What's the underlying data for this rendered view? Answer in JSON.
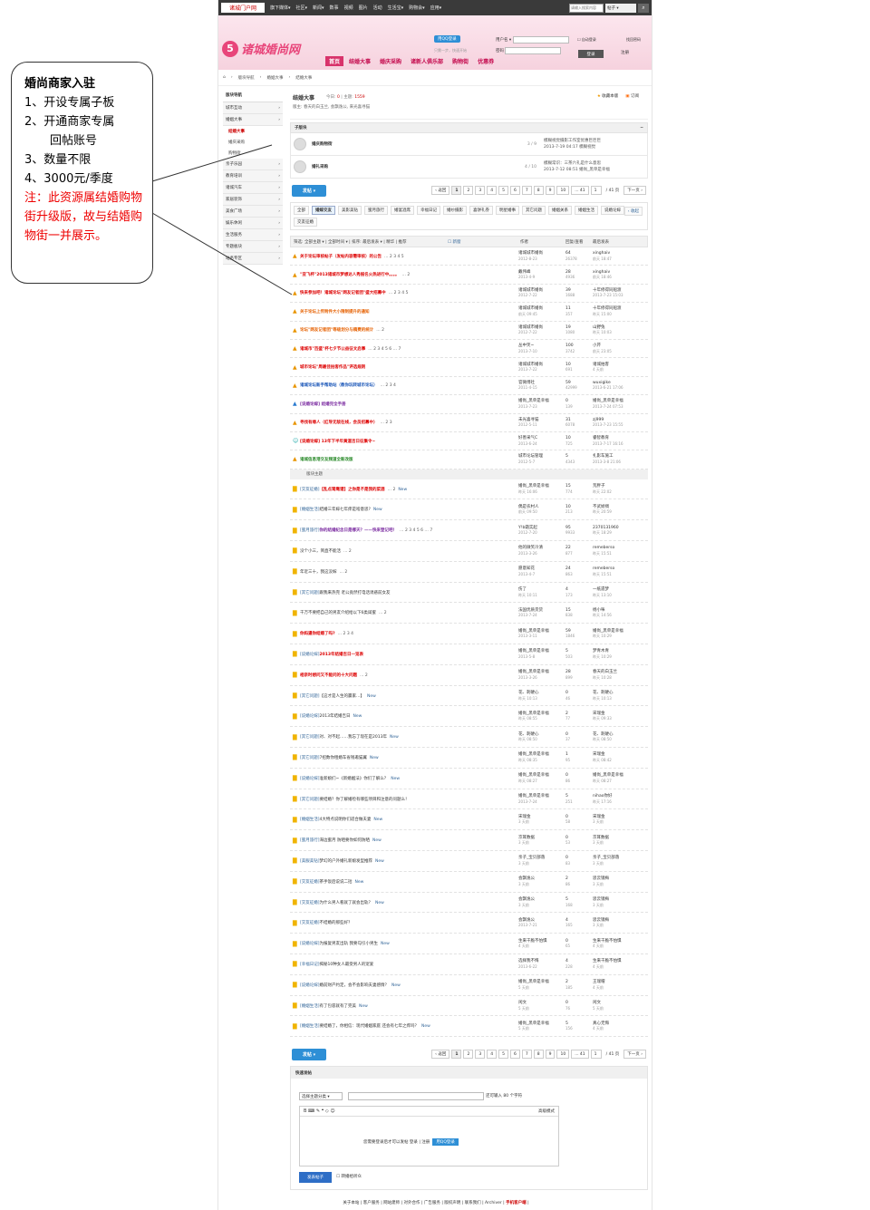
{
  "callout": {
    "title": "婚尚商家入驻",
    "lines": [
      "1、开设专属子板",
      "2、开通商家专属",
      "回帖账号",
      "3、数量不限",
      "4、3000元/季度"
    ],
    "note": "注：此资源属结婚购物街升级版，故与结婚购物街一并展示。"
  },
  "topbar": {
    "logo": "诸城门户网",
    "nav": [
      "旗下媒体▾",
      "社区▾",
      "新闻▾",
      "数事",
      "视频",
      "图片",
      "活动",
      "生活宝▾",
      "购物会▾",
      "应用▾"
    ],
    "search_placeholder": "请输入搜索内容",
    "search_select": "帖子 ▾",
    "search_icon": "magnifier"
  },
  "header": {
    "brand": "诸城婚尚网",
    "qq_login": "用QQ登录",
    "qq_sub": "只需一步，快速开始",
    "user_label": "用户名 ▾",
    "pass_label": "密码",
    "remember": "自动登录",
    "forgot": "找回密码",
    "login_btn": "登录",
    "register_btn": "注册"
  },
  "mainnav": [
    "首页",
    "结婚大事",
    "婚庆采购",
    "诸新人俱乐部",
    "购物街",
    "优惠券"
  ],
  "crumb": [
    "⌂",
    "›",
    "版块导航",
    "›",
    "婚姻大事",
    "›",
    "结婚大事"
  ],
  "sidebar": {
    "head": "版块导航",
    "items": [
      {
        "label": "城市互动",
        "sub": []
      },
      {
        "label": "婚姻大事",
        "sub": [
          "结婚大事",
          "婚庆采购",
          "购物街"
        ]
      },
      {
        "label": "亲子乐园",
        "sub": []
      },
      {
        "label": "教育培训",
        "sub": []
      },
      {
        "label": "诸城汽车",
        "sub": []
      },
      {
        "label": "家居装饰",
        "sub": []
      },
      {
        "label": "美食广场",
        "sub": []
      },
      {
        "label": "娱乐休闲",
        "sub": []
      },
      {
        "label": "生活服务",
        "sub": []
      },
      {
        "label": "专题板块",
        "sub": []
      },
      {
        "label": "站务专区",
        "sub": []
      }
    ]
  },
  "forum": {
    "title": "结婚大事",
    "today_label": "今日:",
    "today": "0",
    "topics_label": "主题:",
    "topics": "1559",
    "mods": "版主: 春天的白玉兰, 会飘逸公, 来光喜寻猫",
    "fav": "收藏本版",
    "rss": "订阅"
  },
  "subforum": {
    "head": "子版块",
    "collapse": "−",
    "rows": [
      {
        "name": "婚庆购物街",
        "count": "3 / 9",
        "last1": "模糊视觉摄影工作室优惠巨巨巨",
        "last2": "2013-7-19 04:17 模糊视觉"
      },
      {
        "name": "婚礼采购",
        "count": "4 / 10",
        "last1": "模糊常识：三茶六礼是什么意思",
        "last2": "2013-7-12 08:51 婚尚_黑单是幸福"
      }
    ]
  },
  "pager": {
    "post": "发帖 ▾",
    "prev": "‹ 返回",
    "pages": [
      "1",
      "2",
      "3",
      "4",
      "5",
      "6",
      "7",
      "8",
      "9",
      "10",
      "... 41"
    ],
    "total": "/ 41 页",
    "next": "下一页 ›",
    "jump": "1"
  },
  "tags": {
    "list": [
      "全部",
      "婚嫁交友",
      "美影美钻",
      "蜜月旅行",
      "婚宴酒席",
      "幸福日记",
      "婚纱摄影",
      "喜饼礼券",
      "明星婚事",
      "其它问题",
      "婚姻关系",
      "婚姻生活",
      "说婚论嫁",
      "交友征婚"
    ],
    "collapse": "‹ 收起"
  },
  "filter": {
    "all": "筛选: 全部主题 ▾",
    "time": "全部时间 ▾",
    "sort": "排序: 最后发表 ▾",
    "hot": "精华",
    "rec": "推荐",
    "new": "新窗",
    "author": "作者",
    "reply": "回复/查看",
    "last": "最后发表"
  },
  "pinned": [
    {
      "icon": "▲",
      "cls": "t-red",
      "title": "关于论坛审核帖子（发帖内容需审核）的公告",
      "pages": "… 2 3 4 5",
      "author": "诸城城市婚尚",
      "adate": "2012-8-23",
      "r": "64",
      "v": "26378",
      "lp": "xinghaiv",
      "ld": "前天 18:47"
    },
    {
      "icon": "▲",
      "cls": "t-red",
      "title": "\"亚飞杯\"2013诸城市梦想达人秀报名火热进行中。。。。",
      "pages": "… 2",
      "author": "戴伟峰",
      "adate": "2013-4-9",
      "r": "28",
      "v": "4936",
      "lp": "xinghaiv",
      "ld": "前天 18:46"
    },
    {
      "icon": "▲",
      "cls": "t-red",
      "title": "快来参加吧！诸城论坛\"网友记者团\"盛大招募中",
      "pages": "… 2 3 4 5",
      "author": "诸城城市婚尚",
      "adate": "2012-7-22",
      "r": "39",
      "v": "1688",
      "lp": "十年修得同船渡",
      "ld": "2013-7-23 15:03"
    },
    {
      "icon": "▲",
      "cls": "t-org",
      "title": "关于论坛上传附件大小限制提升的通知",
      "pages": "",
      "author": "诸城城市婚尚",
      "adate": "前天 09:45",
      "r": "11",
      "v": "357",
      "lp": "十年修得同船渡",
      "ld": "昨天 15:00"
    },
    {
      "icon": "▲",
      "cls": "t-org",
      "title": "论坛\"网友记者团\"等级划分与稿费的统计",
      "pages": "… 2",
      "author": "诸城城市婚尚",
      "adate": "2012-7-22",
      "r": "19",
      "v": "1080",
      "lp": "山野兔",
      "ld": "昨天 10:03"
    },
    {
      "icon": "▲",
      "cls": "t-red",
      "title": "诸城市\"百盛\"杯七夕节公益征文启事",
      "pages": "… 2 3 4 5 6 … 7",
      "author": "丛中笑~",
      "adate": "2013-7-10",
      "r": "100",
      "v": "3742",
      "lp": "小芹",
      "ld": "前天 23:05"
    },
    {
      "icon": "▲",
      "cls": "t-red",
      "title": "城市论坛\"周最佳拍客作品\"评选规则",
      "pages": "",
      "author": "诸城城市婚尚",
      "adate": "2013-7-22",
      "r": "10",
      "v": "691",
      "lp": "诸城拍客",
      "ld": "4 天前"
    },
    {
      "icon": "▲",
      "cls": "t-blue",
      "title": "诸城论坛新手帮助站（教你玩转城市论坛）",
      "pages": "… 2 3 4",
      "author": "官微博社",
      "adate": "2011-4-15",
      "r": "59",
      "v": "42999",
      "lp": "wuxigike",
      "ld": "2013-6-21 17:06"
    },
    {
      "icon": "▲",
      "cls": "t-purple",
      "title": "[说婚论嫁] 结婚完全手册",
      "pages": "",
      "author": "婚尚_黑单是幸福",
      "adate": "2013-7-23",
      "r": "0",
      "v": "139",
      "lp": "婚尚_黑单是幸福",
      "ld": "2013-7-24 07:53"
    },
    {
      "icon": "▲",
      "cls": "t-red",
      "title": "寻找有缘人（红导无敌在线，会员招募中）",
      "pages": "… 2 3",
      "author": "未光喜寻猫",
      "adate": "2012-5-11",
      "r": "31",
      "v": "6078",
      "lp": "zj999",
      "ld": "2013-7-23 15:55"
    },
    {
      "icon": "☺",
      "cls": "t-red",
      "title": "[说婚论嫁] 13年下半年黄道吉日征集令~",
      "pages": "",
      "author": "好善采气C",
      "adate": "2013-6-24",
      "r": "10",
      "v": "725",
      "lp": "睿智教育",
      "ld": "2013-7-17 16:16"
    },
    {
      "icon": "▲",
      "cls": "t-green",
      "title": "诸城信息港交友频道全新改版",
      "pages": "",
      "author": "城市论坛管理",
      "adate": "2012-5-7",
      "r": "5",
      "v": "4343",
      "lp": "扎影车施工",
      "ld": "2013-3-8 21:06"
    }
  ],
  "sep": "版块主题",
  "normal": [
    {
      "tag": "[交友征婚]",
      "cls": "t-red",
      "title": "【乱点鸳鸯谱】之你是不是我的菜酒",
      "pages": "… 2",
      "nw": "New",
      "author": "婚尚_黑单是幸福",
      "adate": "昨天 16:06",
      "r": "15",
      "v": "774",
      "lp": "荒胖子",
      "ld": "昨天 22:02"
    },
    {
      "tag": "[婚姻生活]",
      "cls": "t-plain",
      "title": "结婚三年嫁七年痒是啥意思?",
      "pages": "",
      "nw": "New",
      "author": "偶是农村人",
      "adate": "前天 09:50",
      "r": "10",
      "v": "213",
      "lp": "不武娇绸",
      "ld": "昨天 20:59"
    },
    {
      "tag": "[蜜月旅行]",
      "cls": "t-purple",
      "title": "你的结婚纪念日是哪天？——快来登记吧！",
      "pages": "… 2 3 4 5 6 … 7",
      "nw": "",
      "author": "Y!b霜实起",
      "adate": "2012-7-20",
      "r": "95",
      "v": "9933",
      "lp": "2370131960",
      "ld": "昨天 18:29"
    },
    {
      "tag": "",
      "cls": "t-plain",
      "title": "没个小三，简直不能活",
      "pages": "… 2",
      "nw": "",
      "author": "他的微笑冷清",
      "adate": "2013-3-26",
      "r": "22",
      "v": "877",
      "lp": "remeberso",
      "ld": "昨天 15:51"
    },
    {
      "tag": "",
      "cls": "t-plain",
      "title": "年近三十，我这没嫁",
      "pages": "… 2",
      "nw": "",
      "author": "愿意知花",
      "adate": "2013-4-7",
      "r": "24",
      "v": "863",
      "lp": "remeberso",
      "ld": "昨天 15:51"
    },
    {
      "tag": "[其它问题]",
      "cls": "t-plain",
      "title": "跟我来热完 老公竟然打电话诱惑前女友",
      "pages": "",
      "nw": "",
      "author": "伤了",
      "adate": "昨天 10:11",
      "r": "4",
      "v": "173",
      "lp": "一纸遗梦",
      "ld": "昨天 13:10"
    },
    {
      "tag": "",
      "cls": "t-plain",
      "title": "千万不要把自己的男友介绍给以下6类闺蜜",
      "pages": "… 2",
      "nw": "",
      "author": "法国优质货货",
      "adate": "2013-7-24",
      "r": "15",
      "v": "838",
      "lp": "杨小咪",
      "ld": "昨天 14:56"
    },
    {
      "tag": "",
      "cls": "t-red",
      "title": "你妈逼你结婚了吗?",
      "pages": "… 2 3 4",
      "nw": "",
      "author": "婚尚_黑单是幸福",
      "adate": "2013-3-11",
      "r": "59",
      "v": "1846",
      "lp": "婚尚_黑单是幸福",
      "ld": "昨天 10:29"
    },
    {
      "tag": "[说婚论嫁]",
      "cls": "t-red",
      "title": "2013年结婚吉日一览表",
      "pages": "",
      "nw": "",
      "author": "婚尚_黑单是幸福",
      "adate": "2013-5-8",
      "r": "5",
      "v": "503",
      "lp": "梦青木青",
      "ld": "昨天 10:29"
    },
    {
      "tag": "",
      "cls": "t-red",
      "title": "相亲时想问又不能问的十大问题",
      "pages": "… 2",
      "nw": "",
      "author": "婚尚_黑单是幸福",
      "adate": "2013-3-26",
      "r": "28",
      "v": "899",
      "lp": "春天的白玉兰",
      "ld": "昨天 10:28"
    },
    {
      "tag": "[其它问题]",
      "cls": "t-plain",
      "title": "【这才是人生的赢家…】",
      "pages": "",
      "nw": "New",
      "author": "花、刺硬心",
      "adate": "昨天 10:13",
      "r": "0",
      "v": "46",
      "lp": "花、刺硬心",
      "ld": "昨天 10:13"
    },
    {
      "tag": "[说婚论嫁]",
      "cls": "t-plain",
      "title": "2013年结婚吉日",
      "pages": "",
      "nw": "New",
      "author": "婚尚_黑单是幸福",
      "adate": "昨天 08:55",
      "r": "2",
      "v": "77",
      "lp": "宋瑞金",
      "ld": "昨天 09:33"
    },
    {
      "tag": "[其它问题]",
      "cls": "t-plain",
      "title": "对、对不起……我忘了现在是2013年",
      "pages": "",
      "nw": "New",
      "author": "花、刺硬心",
      "adate": "昨天 08:50",
      "r": "0",
      "v": "37",
      "lp": "花、刺硬心",
      "ld": "昨天 08:50"
    },
    {
      "tag": "[其它问题]",
      "cls": "t-plain",
      "title": "7招数你租婚车省钱邀猫翼",
      "pages": "",
      "nw": "New",
      "author": "婚尚_黑单是幸福",
      "adate": "昨天 08:35",
      "r": "1",
      "v": "95",
      "lp": "宋瑞金",
      "ld": "昨天 08:42"
    },
    {
      "tag": "[说婚论嫁]",
      "cls": "t-plain",
      "title": "准新娘们~《新婚姻法》你们了解么？",
      "pages": "",
      "nw": "New",
      "author": "婚尚_黑单是幸福",
      "adate": "昨天 08:27",
      "r": "0",
      "v": "86",
      "lp": "婚尚_黑单是幸福",
      "ld": "昨天 08:27"
    },
    {
      "tag": "[其它问题]",
      "cls": "t-plain",
      "title": "要结婚？你了解婚检有哪些项目和注意的问题么！",
      "pages": "",
      "nw": "",
      "author": "婚尚_黑单是幸福",
      "adate": "2013-7-24",
      "r": "5",
      "v": "251",
      "lp": "nihao你好",
      "ld": "昨天 17:16"
    },
    {
      "tag": "[婚姻生活]",
      "cls": "t-plain",
      "title": "4大特点说明你们适合做夫妻",
      "pages": "",
      "nw": "New",
      "author": "宋瑞金",
      "adate": "3 天前",
      "r": "0",
      "v": "58",
      "lp": "宋瑞金",
      "ld": "3 天前"
    },
    {
      "tag": "[蜜月旅行]",
      "cls": "t-plain",
      "title": "海边蜜月 防晒要你如何防晒",
      "pages": "",
      "nw": "New",
      "author": "京耳数据",
      "adate": "3 天前",
      "r": "0",
      "v": "53",
      "lp": "京耳数据",
      "ld": "3 天前"
    },
    {
      "tag": "[美服美钻]",
      "cls": "t-plain",
      "title": "梦幻的户外婚礼新娘发型推荐",
      "pages": "",
      "nw": "New",
      "author": "亲子_宝贝部落",
      "adate": "3 天前",
      "r": "0",
      "v": "83",
      "lp": "亲子_宝贝部落",
      "ld": "3 天前"
    },
    {
      "tag": "[交友征婚]",
      "cls": "t-plain",
      "title": "茶手饭后说说二括",
      "pages": "",
      "nw": "New",
      "author": "会飘逸公",
      "adate": "3 天前",
      "r": "2",
      "v": "86",
      "lp": "思云镜梅",
      "ld": "3 天前"
    },
    {
      "tag": "[交友征婚]",
      "cls": "t-plain",
      "title": "为什么男人看就了就会出轨？",
      "pages": "",
      "nw": "New",
      "author": "会飘逸公",
      "adate": "3 天前",
      "r": "5",
      "v": "168",
      "lp": "思云镜梅",
      "ld": "3 天前"
    },
    {
      "tag": "[交友征婚]",
      "cls": "t-plain",
      "title": "不结婚的那些好？",
      "pages": "",
      "nw": "",
      "author": "会飘逸公",
      "adate": "2013-7-21",
      "r": "4",
      "v": "165",
      "lp": "思云镜梅",
      "ld": "3 天前"
    },
    {
      "tag": "[说婚论嫁]",
      "cls": "t-plain",
      "title": "为报复男友出轨 我要勾引小男生",
      "pages": "",
      "nw": "New",
      "author": "生来干脆不怕惧",
      "adate": "4 天前",
      "r": "0",
      "v": "65",
      "lp": "生来干脆不怕惧",
      "ld": "4 天前"
    },
    {
      "tag": "[幸福日记]",
      "cls": "t-plain",
      "title": "揭秘10种女人最受男人的宠爱",
      "pages": "",
      "nw": "",
      "author": "选择我不悔",
      "adate": "2013-6-22",
      "r": "4",
      "v": "228",
      "lp": "生来干脆不怕惧",
      "ld": "4 天前"
    },
    {
      "tag": "[说婚论嫁]",
      "cls": "t-plain",
      "title": "婚前财产约定，会不会影响夫妻感情？",
      "pages": "",
      "nw": "New",
      "author": "婚尚_黑单是幸福",
      "adate": "5 天前",
      "r": "2",
      "v": "185",
      "lp": "王瑞帽",
      "ld": "4 天前"
    },
    {
      "tag": "[婚姻生活]",
      "cls": "t-plain",
      "title": "有了包容就有了完美",
      "pages": "",
      "nw": "New",
      "author": "闲文",
      "adate": "5 天前",
      "r": "0",
      "v": "76",
      "lp": "闲文",
      "ld": "5 天前"
    },
    {
      "tag": "[婚姻生活]",
      "cls": "t-plain",
      "title": "要结婚了，你相信：现代婚姻家庭 还会有七年之痒吗？",
      "pages": "",
      "nw": "New",
      "author": "婚尚_黑单是幸福",
      "adate": "5 天前",
      "r": "5",
      "v": "156",
      "lp": "真心无悔",
      "ld": "4 天前"
    }
  ],
  "quickpost": {
    "head": "快速发帖",
    "select": "选择主题分类 ▾",
    "count_label": "还可输入 80 个字符",
    "tools": "B ⌨ ✎ ❝ ◇ ☺",
    "adv": "高级模式",
    "msg": "您需要登录后才可以发帖 登录 | 注册",
    "qq": "用QQ登录",
    "submit": "发表帖子",
    "check": "转播给听众"
  },
  "footer": {
    "links": "关于本站 | 客户服务 | 网站建师 | 对外合作 | 广告服务 | 版权声明 | 联系我们 | Archiver |",
    "mobile": "手机客户端",
    "end": "|"
  },
  "colors": {
    "brand": "#e8457a",
    "nav_active": "#d8336b",
    "link": "#1a56b8",
    "red": "#d00",
    "qq": "#2e8fd6"
  }
}
